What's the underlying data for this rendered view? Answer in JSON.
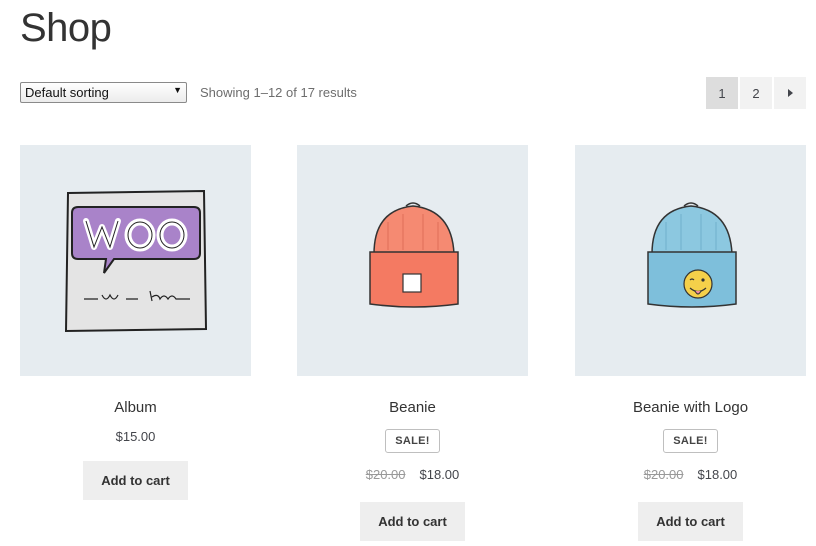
{
  "page": {
    "title": "Shop"
  },
  "toolbar": {
    "sorting_selected": "Default sorting",
    "result_count": "Showing 1–12 of 17 results"
  },
  "pagination": {
    "pages": [
      "1",
      "2"
    ],
    "current": "1",
    "next_icon": "triangle-right-icon"
  },
  "products": [
    {
      "name": "Album",
      "price": "$15.00",
      "on_sale": false,
      "button": "Add to cart",
      "image": "woo-album-cover"
    },
    {
      "name": "Beanie",
      "sale_badge": "SALE!",
      "old_price": "$20.00",
      "price": "$18.00",
      "on_sale": true,
      "button": "Add to cart",
      "image": "orange-beanie"
    },
    {
      "name": "Beanie with Logo",
      "sale_badge": "SALE!",
      "old_price": "$20.00",
      "price": "$18.00",
      "on_sale": true,
      "button": "Add to cart",
      "image": "blue-beanie-with-emoji-logo"
    }
  ],
  "colors": {
    "thumb_bg": "#e6ecf0",
    "button_bg": "#eeeeee",
    "woo_purple": "#a983c9",
    "orange_beanie": "#f58a72",
    "blue_beanie": "#8cc8e0"
  }
}
